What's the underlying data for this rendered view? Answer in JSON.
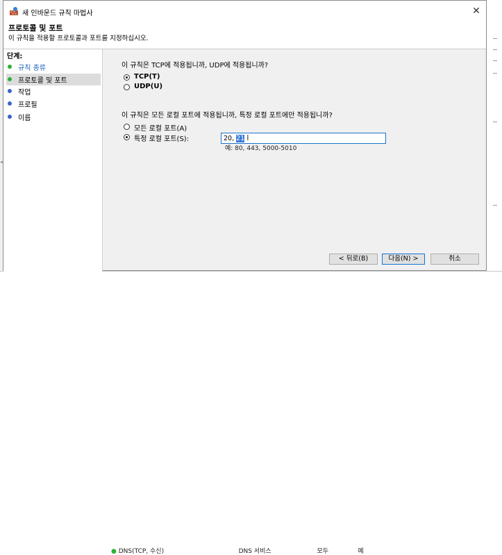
{
  "window": {
    "title": "새 인바운드 규칙 마법사",
    "close_glyph": "✕"
  },
  "header": {
    "title": "프로토콜 및 포트",
    "subtitle": "이 규칙을 적용할 프로토콜과 포트를 지정하십시오."
  },
  "steps": {
    "title": "단계:",
    "items": [
      {
        "label": "규칙 종류",
        "state": "done",
        "dot": "green"
      },
      {
        "label": "프로토콜 및 포트",
        "state": "current",
        "dot": "green"
      },
      {
        "label": "작업",
        "state": "pending",
        "dot": "blue"
      },
      {
        "label": "프로필",
        "state": "pending",
        "dot": "blue"
      },
      {
        "label": "이름",
        "state": "pending",
        "dot": "blue"
      }
    ]
  },
  "protocol": {
    "question": "이 규칙은 TCP에 적용됩니까, UDP에 적용됩니까?",
    "tcp_label": "TCP(T)",
    "udp_label": "UDP(U)",
    "selected": "TCP"
  },
  "ports": {
    "question": "이 규칙은 모든 로컬 포트에 적용됩니까, 특정 로컬 포트에만 적용됩니까?",
    "all_label": "모든 로컬 포트(A)",
    "specific_label": "특정 로컬 포트(S):",
    "selected": "specific",
    "value_prefix": "20, ",
    "value_selected": "21",
    "example": "예: 80, 443, 5000-5010"
  },
  "buttons": {
    "back": "< 뒤로(B)",
    "next": "다음(N) >",
    "cancel": "취소"
  },
  "background": {
    "row_name": "DNS(TCP, 수신)",
    "row_group": "DNS 서비스",
    "row_profile": "모두",
    "row_enabled": "예"
  },
  "colors": {
    "accent": "#0f74d6",
    "done_step_text": "#1b64b8",
    "green_dot": "#2eb134",
    "blue_dot": "#3b64c8"
  }
}
